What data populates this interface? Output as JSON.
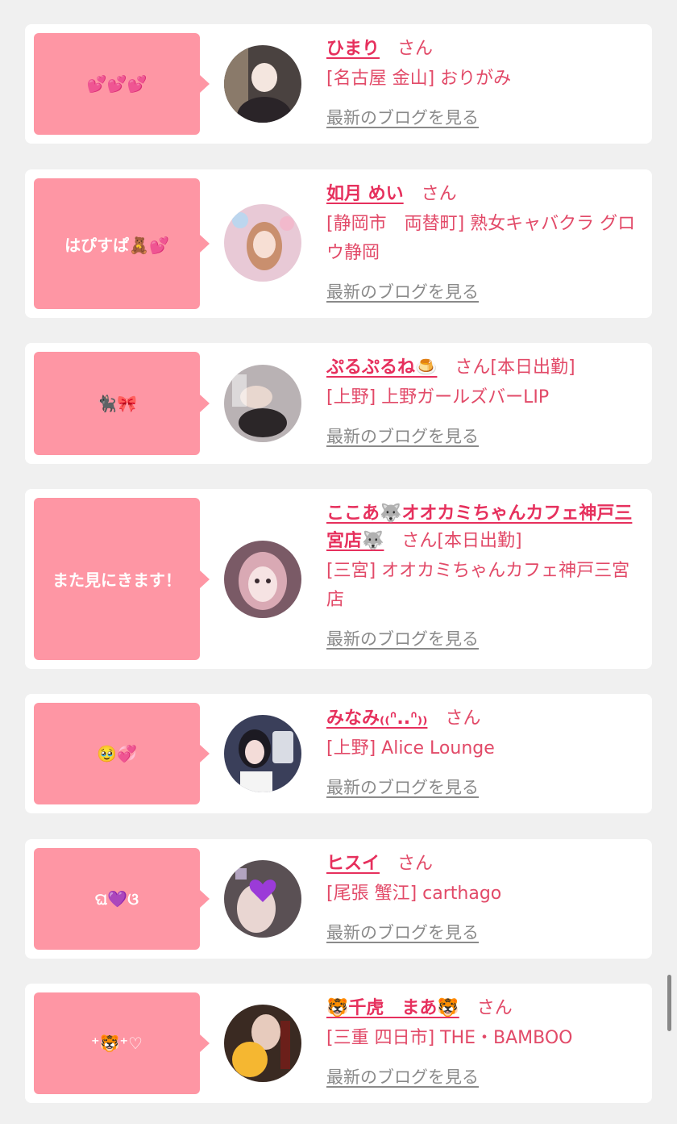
{
  "san_label": "さん",
  "blog_link_label": "最新のブログを見る",
  "cards": [
    {
      "message": "💕💕💕",
      "name": "ひまり",
      "status": "",
      "shop": "[名古屋 金山] おりがみ",
      "avatar_color": "#4a4240"
    },
    {
      "message": "はぴすぱ🧸💕",
      "name": "如月 めい",
      "status": "",
      "shop": "[静岡市　両替町] 熟女キャバクラ グロウ静岡",
      "avatar_color": "#e8c9d6"
    },
    {
      "message": "🐈‍⬛🎀",
      "name": "ぷるぷるね🍮",
      "status": "[本日出勤]",
      "shop": "[上野] 上野ガールズバーLIP",
      "avatar_color": "#b9b2b4"
    },
    {
      "message": "また見にきます！",
      "name": "ここあ🐺オオカミちゃんカフェ神戸三宮店🐺",
      "status": "[本日出勤]",
      "shop": "[三宮] オオカミちゃんカフェ神戸三宮店",
      "avatar_color": "#7a5a66"
    },
    {
      "message": "🥹💞",
      "name": "みなみ₍₍ᐢ..ᐢ₎₎",
      "status": "",
      "shop": "[上野] Alice Lounge",
      "avatar_color": "#3a3f5a"
    },
    {
      "message": "ଘ💜ଓ",
      "name": "ヒスイ",
      "status": "",
      "shop": "[尾張 蟹江] carthago",
      "avatar_color": "#5a5054"
    },
    {
      "message": "⁺🐯⁺♡",
      "name": "🐯千虎　まあ🐯",
      "status": "",
      "shop": "[三重 四日市] THE・BAMBOO",
      "avatar_color": "#3a2a22"
    }
  ]
}
